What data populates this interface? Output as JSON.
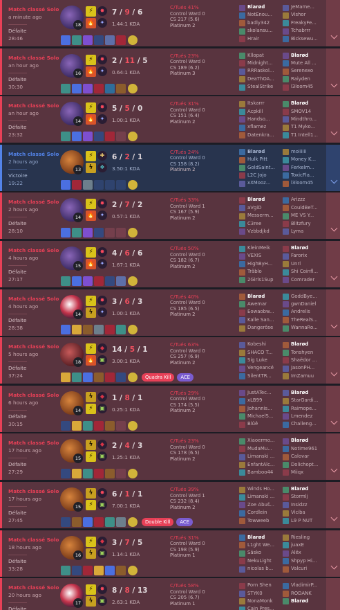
{
  "labels": {
    "kda_suffix": "KDA"
  },
  "matches": [
    {
      "queue": "Match classé Solo",
      "ago": "a minute ago",
      "result": "Défaite",
      "duration": "28:46",
      "champion": "kassadin-icon",
      "level": "18",
      "spells": [
        {
          "name": "flash-icon",
          "glyph": "⚡"
        },
        {
          "name": "ignite-icon",
          "glyph": "🔥"
        }
      ],
      "runes": [
        {
          "name": "electrocute-icon",
          "glyph": "✸"
        },
        {
          "name": "sorcery-icon",
          "glyph": "✦"
        }
      ],
      "k": "7",
      "d": "9",
      "a": "6",
      "kda": "1.44:1 KDA",
      "pkill": "C/Tués 41%",
      "ward": "Control Ward 0",
      "cs": "CS 217 (5.6)",
      "rank": "Platinum 2",
      "items": [
        "#4b6fe0",
        "#3e8f88",
        "#7e4fd0",
        "#34497f",
        "#5e6fa8",
        "#a12738"
      ],
      "ward_color": "#d1b43a",
      "badges": [],
      "blue": [
        "Blarød",
        "NotEnou...",
        "badly342",
        "skolansu...",
        "Hrair"
      ],
      "red": [
        "JeMame...",
        "Vishor",
        "FreakyFe...",
        "Tchabrrr",
        "Bicksewu..."
      ],
      "me_side": "blue",
      "me_index": 0
    },
    {
      "queue": "Match classé Solo",
      "ago": "an hour ago",
      "result": "Défaite",
      "duration": "30:30",
      "champion": "kassadin-icon",
      "level": "16",
      "spells": [
        {
          "name": "flash-icon",
          "glyph": "⚡"
        },
        {
          "name": "ignite-icon",
          "glyph": "🔥"
        }
      ],
      "runes": [
        {
          "name": "electrocute-icon",
          "glyph": "✸"
        },
        {
          "name": "sorcery-icon",
          "glyph": "✦"
        }
      ],
      "k": "2",
      "d": "11",
      "a": "5",
      "kda": "0.64:1 KDA",
      "pkill": "C/Tués 23%",
      "ward": "Control Ward 0",
      "cs": "CS 189 (6.2)",
      "rank": "Platinum 3",
      "items": [
        "#3e8f88",
        "#4b6fe0",
        "#7e4fd0",
        "#a12738",
        "#2f6d9a",
        "#8b5c2c"
      ],
      "ward_color": "#d1b43a",
      "badges": [],
      "blue": [
        "Kllopat",
        "Midnight...",
        "RRRaskol...",
        "DeaThOA...",
        "StealStrike"
      ],
      "red": [
        "Blarød",
        "Mute All ...",
        "Serenexo",
        "Raiyden",
        "l3loom45"
      ],
      "me_side": "red",
      "me_index": 0
    },
    {
      "queue": "Match classé Solo",
      "ago": "an hour ago",
      "result": "Défaite",
      "duration": "23:32",
      "champion": "kassadin-icon",
      "level": "14",
      "spells": [
        {
          "name": "flash-icon",
          "glyph": "⚡"
        },
        {
          "name": "ignite-icon",
          "glyph": "🔥"
        }
      ],
      "runes": [
        {
          "name": "electrocute-icon",
          "glyph": "✸"
        },
        {
          "name": "sorcery-icon",
          "glyph": "✦"
        }
      ],
      "k": "5",
      "d": "5",
      "a": "0",
      "kda": "1.00:1 KDA",
      "pkill": "C/Tués 31%",
      "ward": "Control Ward 0",
      "cs": "CS 151 (6.4)",
      "rank": "Platinum 2",
      "items": [
        "#3e8f88",
        "#4b6fe0",
        "#7e4fd0",
        "#34497f",
        "#a12738",
        ""
      ],
      "ward_color": "#d1b43a",
      "badges": [],
      "blue": [
        "Itskarrr",
        "Acpkill",
        "Handso...",
        "xflamez",
        "Datenkra..."
      ],
      "red": [
        "Blarød",
        "SMOV14",
        "Mindthro...",
        "T1 Myko...",
        "T1 Intell1..."
      ],
      "me_side": "red",
      "me_index": 0
    },
    {
      "queue": "Match classé Solo",
      "ago": "2 hours ago",
      "result": "Victoire",
      "duration": "19:22",
      "champion": "rengar-icon",
      "level": "13",
      "spells": [
        {
          "name": "flash-icon",
          "glyph": "⚡"
        },
        {
          "name": "smite-icon",
          "glyph": "ϟ"
        }
      ],
      "runes": [
        {
          "name": "precision-icon",
          "glyph": "✚"
        },
        {
          "name": "inspiration-icon",
          "glyph": "❖"
        }
      ],
      "k": "6",
      "d": "2",
      "a": "1",
      "kda": "3.50:1 KDA",
      "pkill": "C/Tués 24%",
      "ward": "Control Ward 0",
      "cs": "CS 158 (8.2)",
      "rank": "Platinum 2",
      "items": [
        "#4b6fe0",
        "#a12738",
        "#6d7f8c",
        "",
        "",
        ""
      ],
      "ward_color": "#d1b43a",
      "badges": [],
      "blue": [
        "Blarød",
        "Hulk Pitt",
        "GoldSaint...",
        "L2C Jojo",
        "xXMooz..."
      ],
      "red": [
        "moiiiiii",
        "Money K...",
        "Ferkelm...",
        "ToxicFla...",
        "l3loom45"
      ],
      "me_side": "blue",
      "me_index": 0
    },
    {
      "queue": "Match classé Solo",
      "ago": "2 hours ago",
      "result": "Défaite",
      "duration": "28:10",
      "champion": "kassadin-icon",
      "level": "14",
      "spells": [
        {
          "name": "flash-icon",
          "glyph": "⚡"
        },
        {
          "name": "ignite-icon",
          "glyph": "🔥"
        }
      ],
      "runes": [
        {
          "name": "electrocute-icon",
          "glyph": "✸"
        },
        {
          "name": "sorcery-icon",
          "glyph": "✦"
        }
      ],
      "k": "2",
      "d": "7",
      "a": "2",
      "kda": "0.57:1 KDA",
      "pkill": "C/Tués 33%",
      "ward": "Control Ward 1",
      "cs": "CS 167 (5.9)",
      "rank": "Platinum 2",
      "items": [
        "#4b6fe0",
        "#3e8f88",
        "#7e4fd0",
        "#34497f",
        "",
        ""
      ],
      "ward_color": "#d1b43a",
      "badges": [],
      "blue": [
        "Blarød",
        "aVgiD",
        "Messerm...",
        "C3ree",
        "Vzbbdjkd"
      ],
      "red": [
        "Arizzz",
        "CouldBeT...",
        "ME VS Y...",
        "Blitzfury",
        "Lyma"
      ],
      "me_side": "blue",
      "me_index": 0
    },
    {
      "queue": "Match classé Solo",
      "ago": "4 hours ago",
      "result": "Défaite",
      "duration": "27:17",
      "champion": "kassadin-icon",
      "level": "15",
      "spells": [
        {
          "name": "flash-icon",
          "glyph": "⚡"
        },
        {
          "name": "ignite-icon",
          "glyph": "🔥"
        }
      ],
      "runes": [
        {
          "name": "electrocute-icon",
          "glyph": "✸"
        },
        {
          "name": "sorcery-icon",
          "glyph": "✦"
        }
      ],
      "k": "4",
      "d": "6",
      "a": "6",
      "kda": "1.67:1 KDA",
      "pkill": "C/Tués 50%",
      "ward": "Control Ward 0",
      "cs": "CS 182 (6.7)",
      "rank": "Platinum 2",
      "items": [
        "#3e8f88",
        "#4b6fe0",
        "#7e4fd0",
        "#a12738",
        "#34497f",
        "#5e6fa8"
      ],
      "ward_color": "#d1b43a",
      "badges": [],
      "blue": [
        "KleinMeik",
        "VEXIS",
        "HighByH...",
        "Trâblo",
        "2Girls1Sup"
      ],
      "red": [
        "Blarød",
        "Farorix",
        "Unrl",
        "Shi Coinfl...",
        "Comrader"
      ],
      "me_side": "red",
      "me_index": 0
    },
    {
      "queue": "Match classé Solo",
      "ago": "4 hours ago",
      "result": "Défaite",
      "duration": "28:38",
      "champion": "kayn-icon",
      "level": "14",
      "spells": [
        {
          "name": "flash-icon",
          "glyph": "⚡"
        },
        {
          "name": "smite-icon",
          "glyph": "ϟ"
        }
      ],
      "runes": [
        {
          "name": "electrocute-icon",
          "glyph": "✸"
        },
        {
          "name": "sorcery-icon",
          "glyph": "✦"
        }
      ],
      "k": "3",
      "d": "6",
      "a": "3",
      "kda": "1.00:1 KDA",
      "pkill": "C/Tués 40%",
      "ward": "Control Ward 0",
      "cs": "CS 185 (6.5)",
      "rank": "Platinum 2",
      "items": [
        "#4b6fe0",
        "#d9a83a",
        "#8b5c2c",
        "#6d7f8c",
        "#a12738",
        "#3e8f88"
      ],
      "ward_color": "#d1b43a",
      "badges": [],
      "blue": [
        "Blarød",
        "Awemar",
        "Eowaobw...",
        "Kalle San...",
        "Dangerôse"
      ],
      "red": [
        "GoddBye...",
        "gwnDaniel",
        "Andrelis",
        "TheRealS...",
        "WannaRo..."
      ],
      "me_side": "blue",
      "me_index": 0
    },
    {
      "queue": "Match classé Solo",
      "ago": "5 hours ago",
      "result": "Défaite",
      "duration": "37:24",
      "champion": "katarina-icon",
      "level": "18",
      "spells": [
        {
          "name": "flash-icon",
          "glyph": "⚡"
        },
        {
          "name": "ignite-icon",
          "glyph": "🔥"
        }
      ],
      "runes": [
        {
          "name": "domination-icon",
          "glyph": "◆"
        },
        {
          "name": "resolve-icon",
          "glyph": "▣"
        }
      ],
      "k": "14",
      "d": "5",
      "a": "1",
      "kda": "3.00:1 KDA",
      "pkill": "C/Tués 63%",
      "ward": "Control Ward 0",
      "cs": "CS 257 (6.9)",
      "rank": "Platinum 2",
      "items": [
        "#d9a83a",
        "#3e8f88",
        "#4b6fe0",
        "#8b5c2c",
        "#a12738",
        "#34497f"
      ],
      "ward_color": "#d1b43a",
      "badges": [
        {
          "text": "Quadra Kill",
          "cls": "mk"
        },
        {
          "text": "ACE",
          "cls": "ace"
        }
      ],
      "blue": [
        "Kobeshi",
        "SHACO T...",
        "Sig Luke",
        "Vengeancé",
        "SilentTR..."
      ],
      "red": [
        "Blarød",
        "Tonshyen",
        "Shaëdor ...",
        "JasonPH...",
        "ImZamuu"
      ],
      "me_side": "red",
      "me_index": 0
    },
    {
      "queue": "Match classé Solo",
      "ago": "6 hours ago",
      "result": "Défaite",
      "duration": "30:15",
      "champion": "rengar-icon",
      "level": "14",
      "spells": [
        {
          "name": "smite-icon",
          "glyph": "ϟ"
        },
        {
          "name": "flash-icon",
          "glyph": "⚡"
        }
      ],
      "runes": [
        {
          "name": "domination-icon",
          "glyph": "◆"
        },
        {
          "name": "resolve-icon",
          "glyph": "▣"
        }
      ],
      "k": "1",
      "d": "8",
      "a": "1",
      "kda": "0.25:1 KDA",
      "pkill": "C/Tués 29%",
      "ward": "Control Ward 0",
      "cs": "CS 174 (5.5)",
      "rank": "Platinum 2",
      "items": [
        "#34497f",
        "#d9a83a",
        "#3e8f88",
        "#a12738",
        "#8b5c2c",
        ""
      ],
      "ward_color": "#d1b43a",
      "badges": [],
      "blue": [
        "JustATec...",
        "xLB99",
        "Johannis...",
        "MichaelS...",
        "Blûê"
      ],
      "red": [
        "Blarød",
        "StarGardi...",
        "Raimope...",
        "Lmendez",
        "Challeng..."
      ],
      "me_side": "red",
      "me_index": 0
    },
    {
      "queue": "Match classé Solo",
      "ago": "17 hours ago",
      "result": "Défaite",
      "duration": "27:29",
      "champion": "rengar-icon",
      "level": "15",
      "spells": [
        {
          "name": "smite-icon",
          "glyph": "ϟ"
        },
        {
          "name": "flash-icon",
          "glyph": "⚡"
        }
      ],
      "runes": [
        {
          "name": "domination-icon",
          "glyph": "◆"
        },
        {
          "name": "resolve-icon",
          "glyph": "▣"
        }
      ],
      "k": "2",
      "d": "4",
      "a": "3",
      "kda": "1.25:1 KDA",
      "pkill": "C/Tués 23%",
      "ward": "Control Ward 0",
      "cs": "CS 178 (6.5)",
      "rank": "Platinum 2",
      "items": [
        "#34497f",
        "#d9a83a",
        "#3e8f88",
        "#a12738",
        "#8b5c2c",
        ""
      ],
      "ward_color": "#d1b43a",
      "badges": [],
      "blue": [
        "Xiaoermo...",
        "MudaMu...",
        "Limanski ...",
        "EnfantAlc...",
        "Bamboo44"
      ],
      "red": [
        "Blarød",
        "Notime961",
        "Calovar",
        "Dolichopt...",
        "Miiqx"
      ],
      "me_side": "red",
      "me_index": 0
    },
    {
      "queue": "Match classé Solo",
      "ago": "17 hours ago",
      "result": "Défaite",
      "duration": "27:45",
      "champion": "rengar-icon",
      "level": "15",
      "spells": [
        {
          "name": "smite-icon",
          "glyph": "ϟ"
        },
        {
          "name": "flash-icon",
          "glyph": "⚡"
        }
      ],
      "runes": [
        {
          "name": "electrocute-icon",
          "glyph": "✸"
        },
        {
          "name": "resolve-icon",
          "glyph": "▣"
        }
      ],
      "k": "6",
      "d": "1",
      "a": "1",
      "kda": "7.00:1 KDA",
      "pkill": "C/Tués 39%",
      "ward": "Control Ward 1",
      "cs": "CS 232 (8.4)",
      "rank": "Platinum 2",
      "items": [
        "#34497f",
        "#8b5c2c",
        "#4b6fe0",
        "#a12738",
        "#3e8f88",
        "#6d7f8c"
      ],
      "ward_color": "#d1b43a",
      "badges": [
        {
          "text": "Double Kill",
          "cls": "mk"
        },
        {
          "text": "ACE",
          "cls": "ace"
        }
      ],
      "blue": [
        "Winds Ho...",
        "Limanski ...",
        "Zoe Abuš...",
        "Cordlein",
        "Towweeb"
      ],
      "red": [
        "Blarød",
        "Stormlj",
        "Insidzz",
        "Viciba",
        "L9 P NUT"
      ],
      "me_side": "red",
      "me_index": 0
    },
    {
      "queue": "Match classé Solo",
      "ago": "18 hours ago",
      "result": "Défaite",
      "duration": "33:28",
      "champion": "rengar-icon",
      "level": "16",
      "spells": [
        {
          "name": "flash-icon",
          "glyph": "⚡"
        },
        {
          "name": "smite-icon",
          "glyph": "ϟ"
        }
      ],
      "runes": [
        {
          "name": "domination-icon",
          "glyph": "◆"
        },
        {
          "name": "resolve-icon",
          "glyph": "▣"
        }
      ],
      "k": "3",
      "d": "7",
      "a": "5",
      "kda": "1.14:1 KDA",
      "pkill": "C/Tués 31%",
      "ward": "Control Ward 0",
      "cs": "CS 198 (5.9)",
      "rank": "Platinum 1",
      "items": [
        "#3e8f88",
        "#34497f",
        "#a12738",
        "#d9a83a",
        "#4b6fe0",
        "#8b5c2c"
      ],
      "ward_color": "#d1b43a",
      "badges": [],
      "blue": [
        "Blarød",
        "L1ght We...",
        "Säsko",
        "NekuLight",
        "nicolas b..."
      ],
      "red": [
        "Riesling",
        "juaxE",
        "Alëx",
        "Shpyp Hi...",
        "Valcuri"
      ],
      "me_side": "blue",
      "me_index": 0
    },
    {
      "queue": "Match classé Solo",
      "ago": "20 hours ago",
      "result": "Défaite",
      "duration": "",
      "champion": "kayn-icon",
      "level": "17",
      "spells": [
        {
          "name": "flash-icon",
          "glyph": "⚡"
        },
        {
          "name": "smite-icon",
          "glyph": "ϟ"
        }
      ],
      "runes": [
        {
          "name": "electrocute-icon",
          "glyph": "✸"
        },
        {
          "name": "resolve-icon",
          "glyph": "▣"
        }
      ],
      "k": "8",
      "d": "8",
      "a": "13",
      "kda": "2.63:1 KDA",
      "pkill": "C/Tués 58%",
      "ward": "Control Ward 0",
      "cs": "CS 205 (6.7)",
      "rank": "Platinum 1",
      "items": [
        "#4b6fe0",
        "#d9a83a",
        "#8b5c2c",
        "#a12738",
        "#3e8f88",
        "#34497f"
      ],
      "ward_color": "#d1b43a",
      "badges": [],
      "blue": [
        "Porn Shen",
        "STYK0",
        "NonaMonk",
        "Cain Pres...",
        ""
      ],
      "red": [
        "VladimirP...",
        "RODANK",
        "Blarød",
        "",
        ""
      ],
      "me_side": "red",
      "me_index": 2
    }
  ]
}
